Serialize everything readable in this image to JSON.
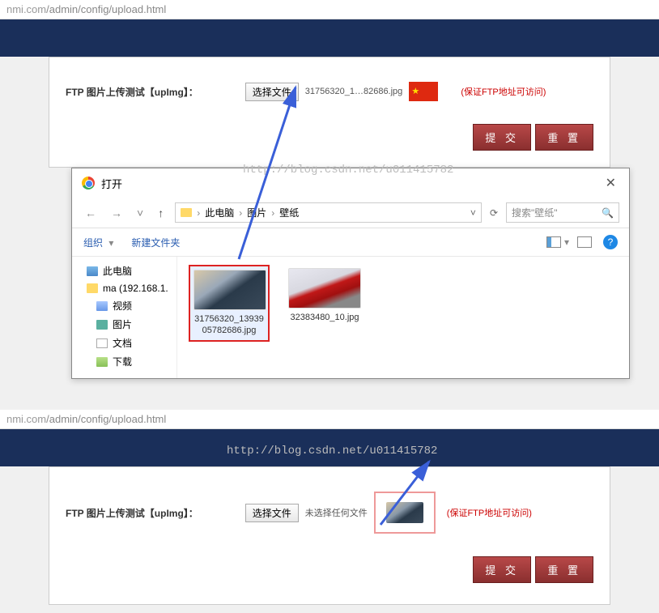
{
  "url": {
    "host": "nmi.com",
    "path": "/admin/config/upload.html"
  },
  "upload": {
    "label": "FTP 图片上传测试【upImg】：",
    "choose_btn": "选择文件",
    "file_name": "31756320_1…82686.jpg",
    "no_file": "未选择任何文件",
    "hint": "(保证FTP地址可访问)"
  },
  "buttons": {
    "submit": "提 交",
    "reset": "重 置"
  },
  "dialog": {
    "title": "打开",
    "breadcrumb": [
      "此电脑",
      "图片",
      "壁纸"
    ],
    "search_placeholder": "搜索\"壁纸\"",
    "organize": "组织",
    "new_folder": "新建文件夹",
    "tree": [
      {
        "label": "此电脑",
        "icon": "pc",
        "indent": 0
      },
      {
        "label": "ma (192.168.1.",
        "icon": "net",
        "indent": 0
      },
      {
        "label": "视频",
        "icon": "vid",
        "indent": 1
      },
      {
        "label": "图片",
        "icon": "pic",
        "indent": 1
      },
      {
        "label": "文档",
        "icon": "doc",
        "indent": 1
      },
      {
        "label": "下载",
        "icon": "dl",
        "indent": 1
      }
    ],
    "files": [
      {
        "name": "31756320_1393905782686.jpg",
        "selected": true,
        "thumb": "car1"
      },
      {
        "name": "32383480_10.jpg",
        "selected": false,
        "thumb": "car2"
      }
    ]
  },
  "watermark": "http://blog.csdn.net/u011415782"
}
